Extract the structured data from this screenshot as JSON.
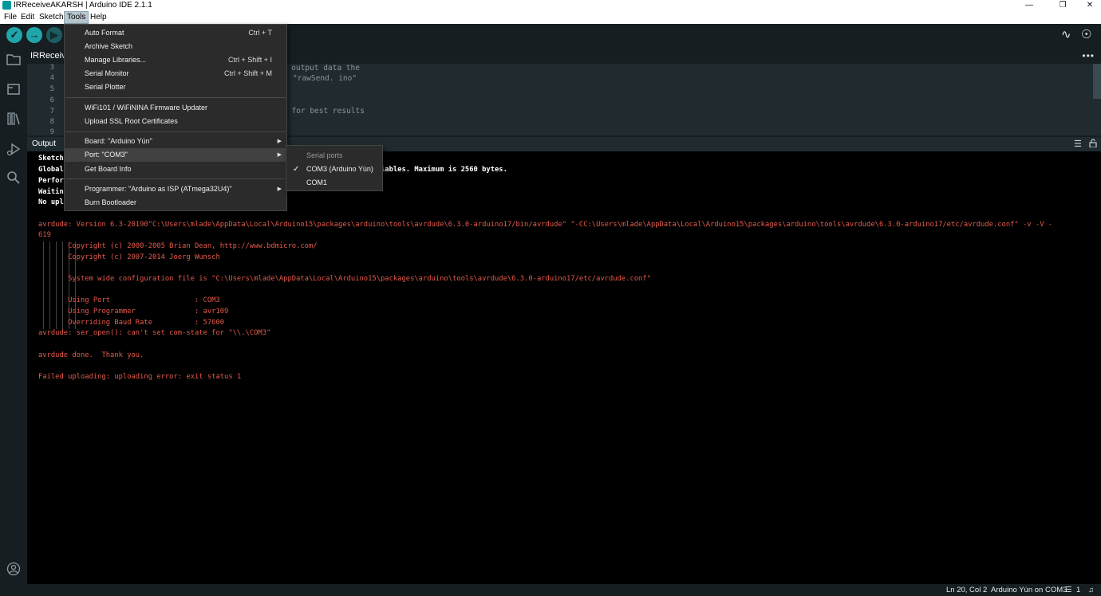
{
  "window": {
    "title": "IRReceiveAKARSH | Arduino IDE 2.1.1",
    "minimize_glyph": "—",
    "restore_glyph": "❐",
    "close_glyph": "✕"
  },
  "menubar": [
    "File",
    "Edit",
    "Sketch",
    "Tools",
    "Help"
  ],
  "toolbar": {
    "verify_glyph": "✓",
    "upload_glyph": "→",
    "debug_glyph": "▶",
    "plotter_glyph": "∿",
    "monitor_glyph": "☉"
  },
  "sidebar_icons": [
    "sketchbook-icon",
    "boards-manager-icon",
    "library-manager-icon",
    "debug-icon",
    "search-icon",
    "account-icon"
  ],
  "editor": {
    "tab_label": "IRReceive",
    "line_numbers": [
      "3",
      "4",
      "5",
      "6",
      "7",
      "8",
      "9"
    ],
    "visible_code": [
      {
        "text": "ll output data the"
      },
      {
        "text": "\"rawSend. ino\""
      },
      {
        "text": "p for best results"
      }
    ]
  },
  "output": {
    "title": "Output",
    "lines": [
      {
        "kind": "w",
        "text": "Sketch"
      },
      {
        "kind": "w",
        "text": "Global                                                                  local variables. Maximum is 2560 bytes."
      },
      {
        "kind": "w",
        "text": "Perfor"
      },
      {
        "kind": "w",
        "text": "Waitin"
      },
      {
        "kind": "w",
        "text": "No upl"
      },
      {
        "kind": "r",
        "text": ""
      },
      {
        "kind": "r",
        "text": "avrdude: Version 6.3-20190\"C:\\Users\\mlade\\AppData\\Local\\Arduino15\\packages\\arduino\\tools\\avrdude\\6.3.0-arduino17/bin/avrdude\" \"-CC:\\Users\\mlade\\AppData\\Local\\Arduino15\\packages\\arduino\\tools\\avrdude\\6.3.0-arduino17/etc/avrdude.conf\" -v -V -"
      },
      {
        "kind": "r",
        "text": "619"
      },
      {
        "kind": "r",
        "text": "       Copyright (c) 2000-2005 Brian Dean, http://www.bdmicro.com/"
      },
      {
        "kind": "r",
        "text": "       Copyright (c) 2007-2014 Joerg Wunsch"
      },
      {
        "kind": "r",
        "text": ""
      },
      {
        "kind": "r",
        "text": "       System wide configuration file is \"C:\\Users\\mlade\\AppData\\Local\\Arduino15\\packages\\arduino\\tools\\avrdude\\6.3.0-arduino17/etc/avrdude.conf\""
      },
      {
        "kind": "r",
        "text": ""
      },
      {
        "kind": "r",
        "text": "       Using Port                    : COM3"
      },
      {
        "kind": "r",
        "text": "       Using Programmer              : avr109"
      },
      {
        "kind": "r",
        "text": "       Overriding Baud Rate          : 57600"
      },
      {
        "kind": "r",
        "text": "avrdude: ser_open(): can't set com-state for \"\\\\.\\COM3\""
      },
      {
        "kind": "r",
        "text": ""
      },
      {
        "kind": "r",
        "text": "avrdude done.  Thank you."
      },
      {
        "kind": "r",
        "text": ""
      },
      {
        "kind": "r",
        "text": "Failed uploading: uploading error: exit status 1"
      }
    ]
  },
  "tools_menu": {
    "items": [
      {
        "label": "Auto Format",
        "shortcut": "Ctrl + T"
      },
      {
        "label": "Archive Sketch",
        "shortcut": ""
      },
      {
        "label": "Manage Libraries...",
        "shortcut": "Ctrl + Shift + I"
      },
      {
        "label": "Serial Monitor",
        "shortcut": "Ctrl + Shift + M"
      },
      {
        "label": "Serial Plotter",
        "shortcut": ""
      },
      {
        "label": "WiFi101 / WiFiNINA Firmware Updater",
        "shortcut": ""
      },
      {
        "label": "Upload SSL Root Certificates",
        "shortcut": ""
      },
      {
        "label": "Board: \"Arduino Yún\"",
        "shortcut": ""
      },
      {
        "label": "Port: \"COM3\"",
        "shortcut": ""
      },
      {
        "label": "Get Board Info",
        "shortcut": ""
      },
      {
        "label": "Programmer: \"Arduino as ISP (ATmega32U4)\"",
        "shortcut": ""
      },
      {
        "label": "Burn Bootloader",
        "shortcut": ""
      }
    ]
  },
  "port_submenu": {
    "header": "Serial ports",
    "options": [
      "COM3 (Arduino Yún)",
      "COM1"
    ],
    "selected": "COM3 (Arduino Yún)",
    "check_glyph": "✓"
  },
  "status": {
    "cursor": "Ln 20, Col 2",
    "board": "Arduino Yún on COM3",
    "notifications": "1"
  }
}
